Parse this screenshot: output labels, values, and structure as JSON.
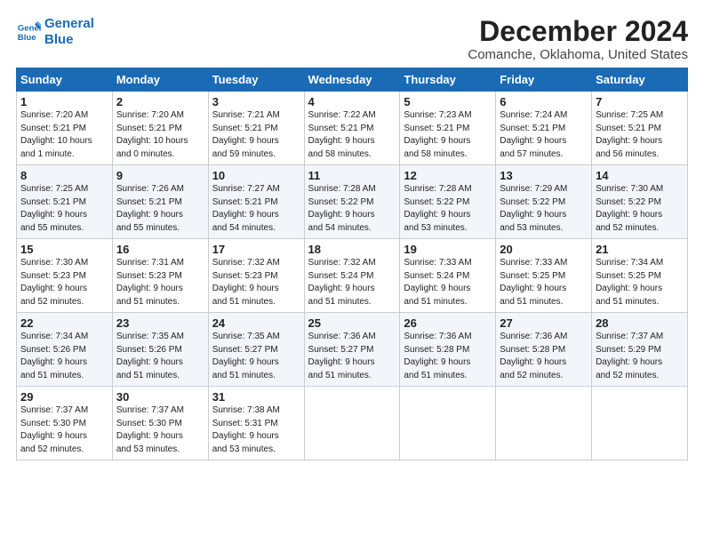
{
  "logo": {
    "line1": "General",
    "line2": "Blue"
  },
  "title": "December 2024",
  "subtitle": "Comanche, Oklahoma, United States",
  "days_header": [
    "Sunday",
    "Monday",
    "Tuesday",
    "Wednesday",
    "Thursday",
    "Friday",
    "Saturday"
  ],
  "weeks": [
    [
      {
        "day": "1",
        "info": "Sunrise: 7:20 AM\nSunset: 5:21 PM\nDaylight: 10 hours\nand 1 minute."
      },
      {
        "day": "2",
        "info": "Sunrise: 7:20 AM\nSunset: 5:21 PM\nDaylight: 10 hours\nand 0 minutes."
      },
      {
        "day": "3",
        "info": "Sunrise: 7:21 AM\nSunset: 5:21 PM\nDaylight: 9 hours\nand 59 minutes."
      },
      {
        "day": "4",
        "info": "Sunrise: 7:22 AM\nSunset: 5:21 PM\nDaylight: 9 hours\nand 58 minutes."
      },
      {
        "day": "5",
        "info": "Sunrise: 7:23 AM\nSunset: 5:21 PM\nDaylight: 9 hours\nand 58 minutes."
      },
      {
        "day": "6",
        "info": "Sunrise: 7:24 AM\nSunset: 5:21 PM\nDaylight: 9 hours\nand 57 minutes."
      },
      {
        "day": "7",
        "info": "Sunrise: 7:25 AM\nSunset: 5:21 PM\nDaylight: 9 hours\nand 56 minutes."
      }
    ],
    [
      {
        "day": "8",
        "info": "Sunrise: 7:25 AM\nSunset: 5:21 PM\nDaylight: 9 hours\nand 55 minutes."
      },
      {
        "day": "9",
        "info": "Sunrise: 7:26 AM\nSunset: 5:21 PM\nDaylight: 9 hours\nand 55 minutes."
      },
      {
        "day": "10",
        "info": "Sunrise: 7:27 AM\nSunset: 5:21 PM\nDaylight: 9 hours\nand 54 minutes."
      },
      {
        "day": "11",
        "info": "Sunrise: 7:28 AM\nSunset: 5:22 PM\nDaylight: 9 hours\nand 54 minutes."
      },
      {
        "day": "12",
        "info": "Sunrise: 7:28 AM\nSunset: 5:22 PM\nDaylight: 9 hours\nand 53 minutes."
      },
      {
        "day": "13",
        "info": "Sunrise: 7:29 AM\nSunset: 5:22 PM\nDaylight: 9 hours\nand 53 minutes."
      },
      {
        "day": "14",
        "info": "Sunrise: 7:30 AM\nSunset: 5:22 PM\nDaylight: 9 hours\nand 52 minutes."
      }
    ],
    [
      {
        "day": "15",
        "info": "Sunrise: 7:30 AM\nSunset: 5:23 PM\nDaylight: 9 hours\nand 52 minutes."
      },
      {
        "day": "16",
        "info": "Sunrise: 7:31 AM\nSunset: 5:23 PM\nDaylight: 9 hours\nand 51 minutes."
      },
      {
        "day": "17",
        "info": "Sunrise: 7:32 AM\nSunset: 5:23 PM\nDaylight: 9 hours\nand 51 minutes."
      },
      {
        "day": "18",
        "info": "Sunrise: 7:32 AM\nSunset: 5:24 PM\nDaylight: 9 hours\nand 51 minutes."
      },
      {
        "day": "19",
        "info": "Sunrise: 7:33 AM\nSunset: 5:24 PM\nDaylight: 9 hours\nand 51 minutes."
      },
      {
        "day": "20",
        "info": "Sunrise: 7:33 AM\nSunset: 5:25 PM\nDaylight: 9 hours\nand 51 minutes."
      },
      {
        "day": "21",
        "info": "Sunrise: 7:34 AM\nSunset: 5:25 PM\nDaylight: 9 hours\nand 51 minutes."
      }
    ],
    [
      {
        "day": "22",
        "info": "Sunrise: 7:34 AM\nSunset: 5:26 PM\nDaylight: 9 hours\nand 51 minutes."
      },
      {
        "day": "23",
        "info": "Sunrise: 7:35 AM\nSunset: 5:26 PM\nDaylight: 9 hours\nand 51 minutes."
      },
      {
        "day": "24",
        "info": "Sunrise: 7:35 AM\nSunset: 5:27 PM\nDaylight: 9 hours\nand 51 minutes."
      },
      {
        "day": "25",
        "info": "Sunrise: 7:36 AM\nSunset: 5:27 PM\nDaylight: 9 hours\nand 51 minutes."
      },
      {
        "day": "26",
        "info": "Sunrise: 7:36 AM\nSunset: 5:28 PM\nDaylight: 9 hours\nand 51 minutes."
      },
      {
        "day": "27",
        "info": "Sunrise: 7:36 AM\nSunset: 5:28 PM\nDaylight: 9 hours\nand 52 minutes."
      },
      {
        "day": "28",
        "info": "Sunrise: 7:37 AM\nSunset: 5:29 PM\nDaylight: 9 hours\nand 52 minutes."
      }
    ],
    [
      {
        "day": "29",
        "info": "Sunrise: 7:37 AM\nSunset: 5:30 PM\nDaylight: 9 hours\nand 52 minutes."
      },
      {
        "day": "30",
        "info": "Sunrise: 7:37 AM\nSunset: 5:30 PM\nDaylight: 9 hours\nand 53 minutes."
      },
      {
        "day": "31",
        "info": "Sunrise: 7:38 AM\nSunset: 5:31 PM\nDaylight: 9 hours\nand 53 minutes."
      },
      {
        "day": "",
        "info": ""
      },
      {
        "day": "",
        "info": ""
      },
      {
        "day": "",
        "info": ""
      },
      {
        "day": "",
        "info": ""
      }
    ]
  ]
}
